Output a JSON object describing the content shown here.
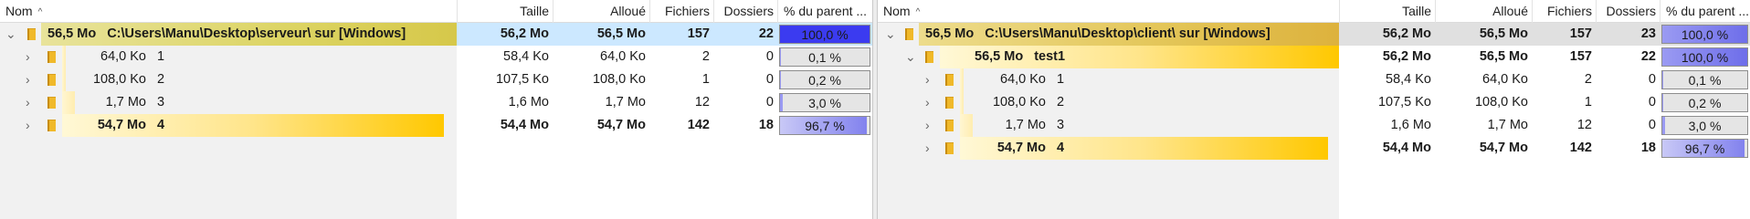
{
  "columns": {
    "name": "Nom",
    "taille": "Taille",
    "alloue": "Alloué",
    "fichiers": "Fichiers",
    "dossiers": "Dossiers",
    "pct": "% du parent ..."
  },
  "left_pane": {
    "root": {
      "size": "56,5 Mo",
      "path": "C:\\Users\\Manu\\Desktop\\serveur\\  sur  [Windows]",
      "taille": "56,2 Mo",
      "alloue": "56,5 Mo",
      "fichiers": "157",
      "dossiers": "22",
      "pct": "100,0 %",
      "pct_value": 1.0
    },
    "rows": [
      {
        "size": "64,0 Ko",
        "name": "1",
        "taille": "58,4 Ko",
        "alloue": "64,0 Ko",
        "fichiers": "2",
        "dossiers": "0",
        "pct": "0,1 %",
        "pct_value": 0.001
      },
      {
        "size": "108,0 Ko",
        "name": "2",
        "taille": "107,5 Ko",
        "alloue": "108,0 Ko",
        "fichiers": "1",
        "dossiers": "0",
        "pct": "0,2 %",
        "pct_value": 0.002
      },
      {
        "size": "1,7 Mo",
        "name": "3",
        "taille": "1,6 Mo",
        "alloue": "1,7 Mo",
        "fichiers": "12",
        "dossiers": "0",
        "pct": "3,0 %",
        "pct_value": 0.03
      },
      {
        "size": "54,7 Mo",
        "name": "4",
        "taille": "54,4 Mo",
        "alloue": "54,7 Mo",
        "fichiers": "142",
        "dossiers": "18",
        "pct": "96,7 %",
        "pct_value": 0.967
      }
    ]
  },
  "right_pane": {
    "root": {
      "size": "56,5 Mo",
      "path": "C:\\Users\\Manu\\Desktop\\client\\  sur  [Windows]",
      "taille": "56,2 Mo",
      "alloue": "56,5 Mo",
      "fichiers": "157",
      "dossiers": "23",
      "pct": "100,0 %",
      "pct_value": 1.0
    },
    "sub": {
      "size": "56,5 Mo",
      "name": "test1",
      "taille": "56,2 Mo",
      "alloue": "56,5 Mo",
      "fichiers": "157",
      "dossiers": "22",
      "pct": "100,0 %",
      "pct_value": 1.0
    },
    "rows": [
      {
        "size": "64,0 Ko",
        "name": "1",
        "taille": "58,4 Ko",
        "alloue": "64,0 Ko",
        "fichiers": "2",
        "dossiers": "0",
        "pct": "0,1 %",
        "pct_value": 0.001
      },
      {
        "size": "108,0 Ko",
        "name": "2",
        "taille": "107,5 Ko",
        "alloue": "108,0 Ko",
        "fichiers": "1",
        "dossiers": "0",
        "pct": "0,2 %",
        "pct_value": 0.002
      },
      {
        "size": "1,7 Mo",
        "name": "3",
        "taille": "1,6 Mo",
        "alloue": "1,7 Mo",
        "fichiers": "12",
        "dossiers": "0",
        "pct": "3,0 %",
        "pct_value": 0.03
      },
      {
        "size": "54,7 Mo",
        "name": "4",
        "taille": "54,4 Mo",
        "alloue": "54,7 Mo",
        "fichiers": "142",
        "dossiers": "18",
        "pct": "96,7 %",
        "pct_value": 0.967
      }
    ]
  },
  "icons": {
    "expand": "chevron-right-icon",
    "collapse": "chevron-down-icon",
    "folder": "folder-icon",
    "sort": "sort-asc-icon"
  },
  "colors": {
    "pct_full": "#3b3bf0",
    "pct_high": "#9a9af2",
    "selection": "#cce8ff",
    "bar_end": "#ffc800"
  }
}
